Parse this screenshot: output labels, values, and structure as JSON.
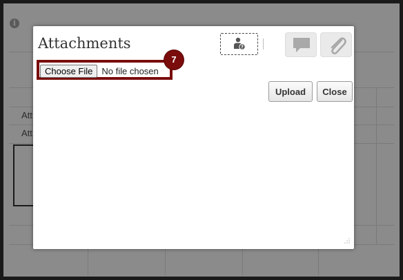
{
  "background": {
    "row_labels": [
      "Att",
      "Att"
    ]
  },
  "dialog": {
    "title": "Attachments",
    "file_input": {
      "button_label": "Choose File",
      "status_text": "No file chosen"
    },
    "step_badge": "7",
    "buttons": {
      "upload": "Upload",
      "close": "Close"
    },
    "toolbar_icons": [
      "user-help-icon",
      "comment-icon",
      "paperclip-icon"
    ]
  },
  "colors": {
    "highlight": "#7a0c0c",
    "overlay": "#8b8b8b",
    "toolbar_button_bg": "#eaeaea"
  }
}
